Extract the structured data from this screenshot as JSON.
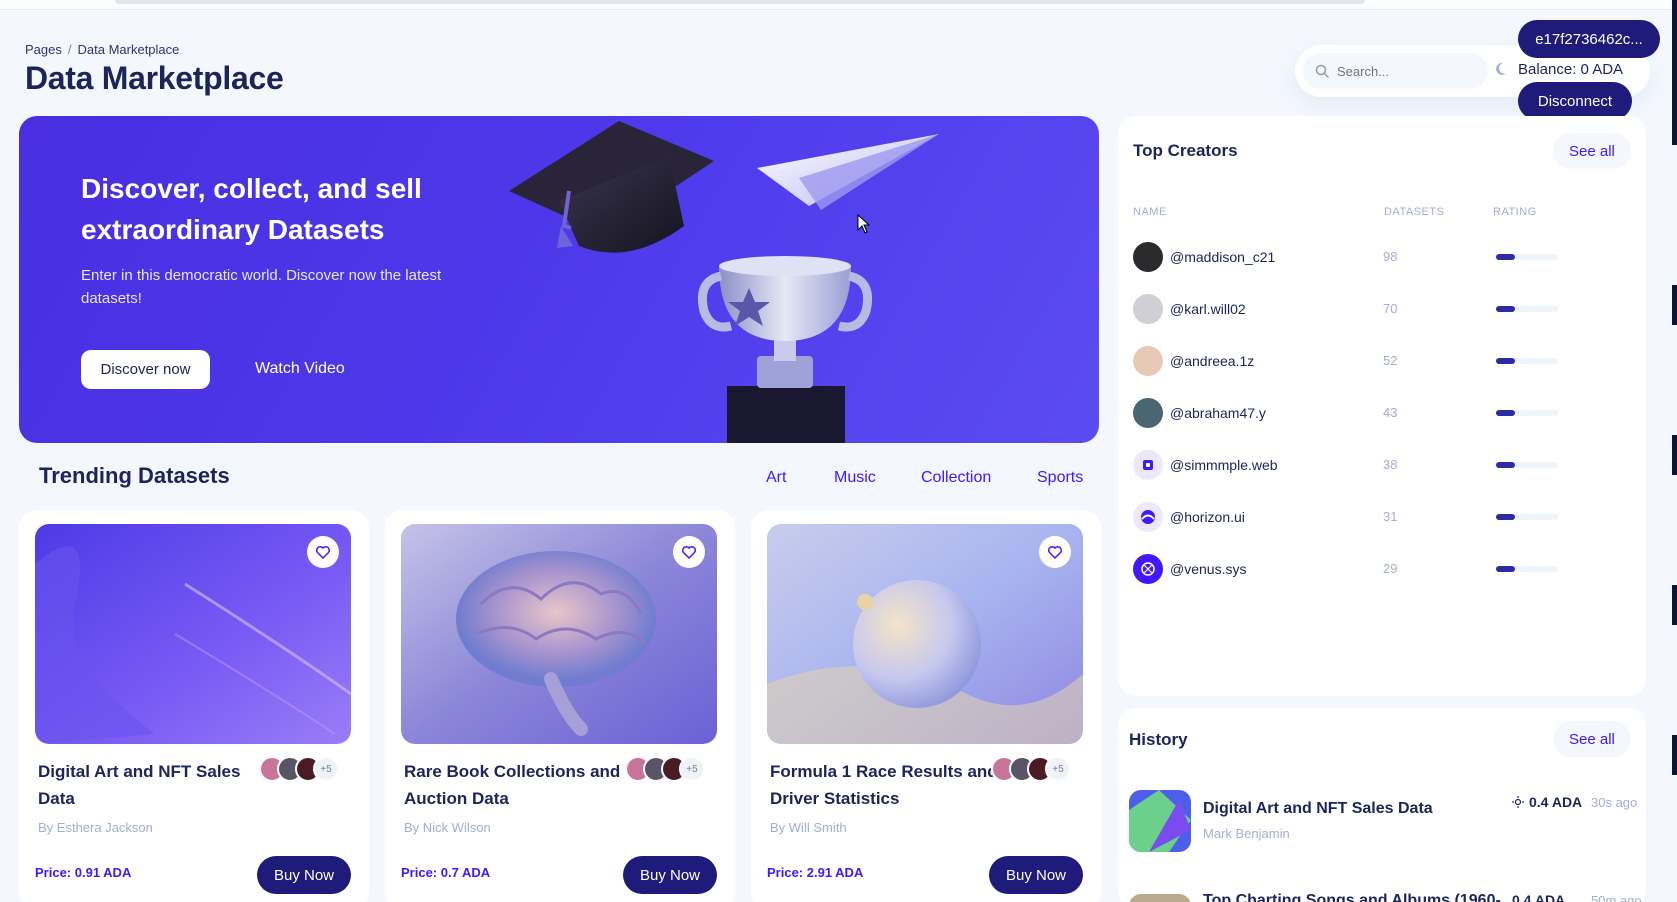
{
  "breadcrumb": {
    "root": "Pages",
    "current": "Data Marketplace"
  },
  "page_title": "Data Marketplace",
  "header": {
    "search_placeholder": "Search...",
    "wallet_address": "e17f2736462c...",
    "balance": "Balance: 0 ADA",
    "disconnect_label": "Disconnect"
  },
  "hero": {
    "title": "Discover, collect, and sell extraordinary Datasets",
    "subtitle": "Enter in this democratic world. Discover now the latest datasets!",
    "primary_label": "Discover now",
    "secondary_label": "Watch Video"
  },
  "trending": {
    "title": "Trending Datasets",
    "tabs": [
      "Art",
      "Music",
      "Collection",
      "Sports"
    ],
    "cards": [
      {
        "title": "Digital Art and NFT Sales Data",
        "author": "By Esthera Jackson",
        "price": "Price: 0.91 ADA",
        "more": "+5",
        "buy_label": "Buy Now"
      },
      {
        "title": "Rare Book Collections and Auction Data",
        "author": "By Nick Wilson",
        "price": "Price: 0.7 ADA",
        "more": "+5",
        "buy_label": "Buy Now"
      },
      {
        "title": "Formula 1 Race Results and Driver Statistics",
        "author": "By Will Smith",
        "price": "Price: 2.91 ADA",
        "more": "+5",
        "buy_label": "Buy Now"
      }
    ]
  },
  "top_creators": {
    "title": "Top Creators",
    "see_all": "See all",
    "columns": [
      "NAME",
      "DATASETS",
      "RATING"
    ],
    "rows": [
      {
        "name": "@maddison_c21",
        "datasets": "98",
        "rating": 0.3
      },
      {
        "name": "@karl.will02",
        "datasets": "70",
        "rating": 0.3
      },
      {
        "name": "@andreea.1z",
        "datasets": "52",
        "rating": 0.3
      },
      {
        "name": "@abraham47.y",
        "datasets": "43",
        "rating": 0.3
      },
      {
        "name": "@simmmple.web",
        "datasets": "38",
        "rating": 0.3
      },
      {
        "name": "@horizon.ui",
        "datasets": "31",
        "rating": 0.3
      },
      {
        "name": "@venus.sys",
        "datasets": "29",
        "rating": 0.3
      }
    ]
  },
  "history": {
    "title": "History",
    "see_all": "See all",
    "items": [
      {
        "name": "Digital Art and NFT Sales Data",
        "author": "Mark Benjamin",
        "price": "0.4 ADA",
        "time": "30s ago"
      },
      {
        "name": "Top Charting Songs and Albums (1960-",
        "price": "0.4 ADA",
        "time": "50m ago"
      }
    ]
  },
  "colors": {
    "accent": "#4318ff",
    "navy": "#1e1b7b",
    "hero": "#4c38ea",
    "text": "#1b2559",
    "muted": "#a3aed0"
  }
}
